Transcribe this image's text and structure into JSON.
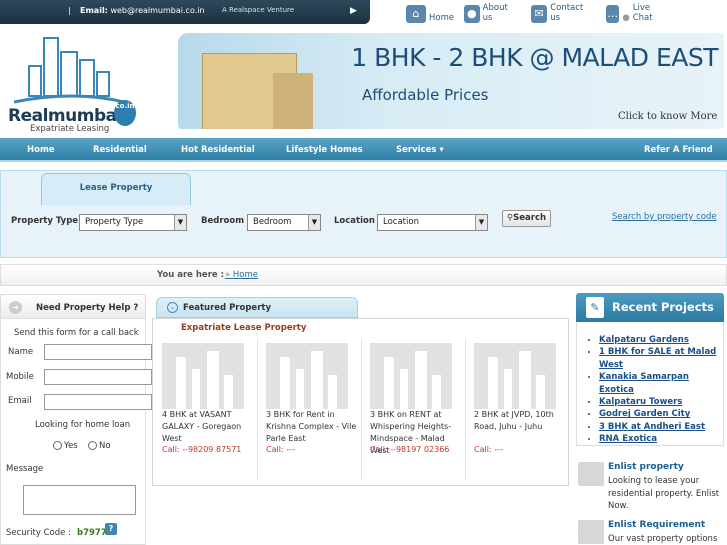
{
  "topbar": {
    "separator": "|",
    "email_label": "Email:",
    "email_value": "web@realmumbai.co.in",
    "venture": "A Realspace Venture",
    "links": [
      {
        "label": "Home",
        "icon": "home-icon"
      },
      {
        "label": "About us",
        "icon": "person-icon"
      },
      {
        "label": "Contact us",
        "icon": "mail-icon"
      },
      {
        "label": "Live Chat",
        "icon": "chat-icon"
      }
    ]
  },
  "logo": {
    "name": "Realmumbai",
    "domain": "co.in",
    "tagline": "Expatriate Leasing"
  },
  "banner": {
    "headline": "1 BHK - 2 BHK @ MALAD EAST",
    "subline": "Affordable Prices",
    "cta": "Click to know More"
  },
  "nav": {
    "items": [
      "Home",
      "Residential",
      "Hot Residential",
      "Lifestyle Homes",
      "Services ▾",
      "Refer A Friend"
    ]
  },
  "lease": {
    "tab": "Lease Property",
    "property_type_label": "Property Type :",
    "property_type_value": "Property Type",
    "bedroom_label": "Bedroom :",
    "bedroom_value": "Bedroom",
    "location_label": "Location :",
    "location_value": "Location",
    "search_button": "Search",
    "search_by_code": "Search by property code"
  },
  "breadcrumb": {
    "label": "You are here :",
    "home": "Home"
  },
  "help": {
    "title": "Need Property Help ?",
    "intro": "Send this form for a call back",
    "name_label": "Name",
    "mobile_label": "Mobile",
    "email_label": "Email",
    "loan_question": "Looking for home loan",
    "yes": "Yes",
    "no": "No",
    "message_label": "Message",
    "security_label": "Security Code :",
    "security_code": "b7977",
    "help_icon": "?"
  },
  "featured": {
    "tab": "Featured Property",
    "subtitle": "Expatriate Lease Property",
    "cards": [
      {
        "title": "4 BHK at VASANT GALAXY - Goregaon West",
        "call": "Call: --98209 87571"
      },
      {
        "title": "3 BHK for Rent in Krishna Complex - Vile Parle East",
        "call": "Call: ---"
      },
      {
        "title": "3 BHK on RENT at Whispering Heights- Mindspace - Malad West",
        "call": "Call: --98197 02366"
      },
      {
        "title": "2 BHK at JVPD, 10th Road, Juhu - Juhu",
        "call": "Call: ---"
      }
    ]
  },
  "recent": {
    "title": "Recent Projects",
    "items": [
      "Kalpataru Gardens",
      "1 BHK for SALE at Malad West",
      "Kanakia Samarpan Exotica",
      "Kalpataru Towers",
      "Godrej Garden City",
      "3 BHK at Andheri East",
      "RNA Exotica"
    ]
  },
  "enlist_property": {
    "title": "Enlist property",
    "text": "Looking to lease your residential property. Enlist Now."
  },
  "enlist_requirement": {
    "title": "Enlist Requirement",
    "text": "Our vast property options the"
  }
}
